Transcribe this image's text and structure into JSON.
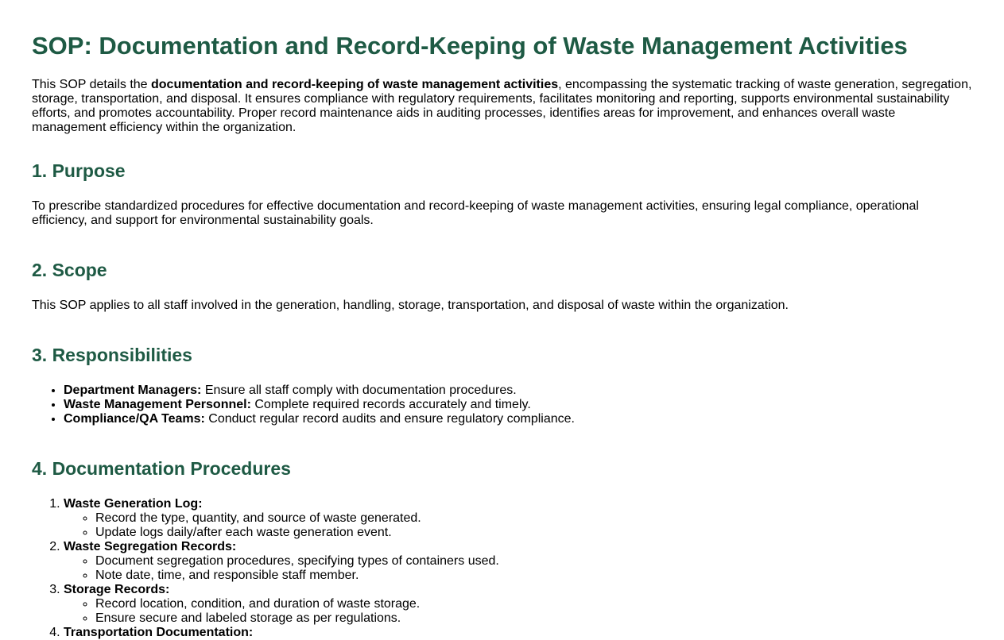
{
  "title": "SOP: Documentation and Record-Keeping of Waste Management Activities",
  "intro": {
    "prefix": "This SOP details the ",
    "bold": "documentation and record-keeping of waste management activities",
    "suffix": ", encompassing the systematic tracking of waste generation, segregation, storage, transportation, and disposal. It ensures compliance with regulatory requirements, facilitates monitoring and reporting, supports environmental sustainability efforts, and promotes accountability. Proper record maintenance aids in auditing processes, identifies areas for improvement, and enhances overall waste management efficiency within the organization."
  },
  "sections": {
    "purpose": {
      "heading": "1. Purpose",
      "text": "To prescribe standardized procedures for effective documentation and record-keeping of waste management activities, ensuring legal compliance, operational efficiency, and support for environmental sustainability goals."
    },
    "scope": {
      "heading": "2. Scope",
      "text": "This SOP applies to all staff involved in the generation, handling, storage, transportation, and disposal of waste within the organization."
    },
    "responsibilities": {
      "heading": "3. Responsibilities",
      "items": [
        {
          "role": "Department Managers:",
          "text": " Ensure all staff comply with documentation procedures."
        },
        {
          "role": "Waste Management Personnel:",
          "text": " Complete required records accurately and timely."
        },
        {
          "role": "Compliance/QA Teams:",
          "text": " Conduct regular record audits and ensure regulatory compliance."
        }
      ]
    },
    "procedures": {
      "heading": "4. Documentation Procedures",
      "steps": [
        {
          "title": "Waste Generation Log:",
          "subitems": [
            "Record the type, quantity, and source of waste generated.",
            "Update logs daily/after each waste generation event."
          ]
        },
        {
          "title": "Waste Segregation Records:",
          "subitems": [
            "Document segregation procedures, specifying types of containers used.",
            "Note date, time, and responsible staff member."
          ]
        },
        {
          "title": "Storage Records:",
          "subitems": [
            "Record location, condition, and duration of waste storage.",
            "Ensure secure and labeled storage as per regulations."
          ]
        },
        {
          "title": "Transportation Documentation:",
          "subitems": []
        }
      ]
    }
  }
}
